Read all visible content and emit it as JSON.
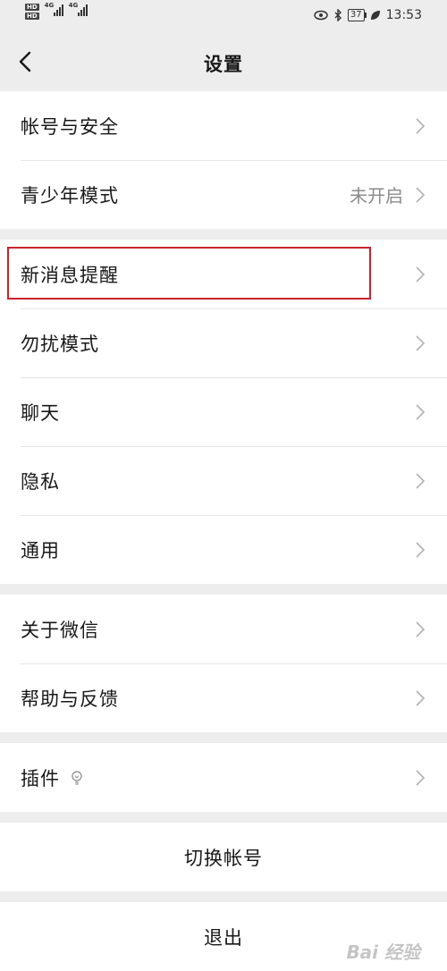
{
  "status_bar": {
    "hd1": "HD",
    "hd2": "HD",
    "net1": "4G",
    "net2": "4G",
    "battery": "37",
    "time": "13:53"
  },
  "nav": {
    "title": "设置",
    "back_icon": "chevron-left-icon"
  },
  "groups": [
    {
      "items": [
        {
          "label": "帐号与安全",
          "value": ""
        },
        {
          "label": "青少年模式",
          "value": "未开启"
        }
      ]
    },
    {
      "items": [
        {
          "label": "新消息提醒",
          "value": ""
        },
        {
          "label": "勿扰模式",
          "value": ""
        },
        {
          "label": "聊天",
          "value": ""
        },
        {
          "label": "隐私",
          "value": ""
        },
        {
          "label": "通用",
          "value": ""
        }
      ]
    },
    {
      "items": [
        {
          "label": "关于微信",
          "value": ""
        },
        {
          "label": "帮助与反馈",
          "value": ""
        }
      ]
    },
    {
      "items": [
        {
          "label": "插件",
          "value": "",
          "icon": "lightbulb-icon"
        }
      ]
    }
  ],
  "actions": {
    "switch_account": "切换帐号",
    "logout": "退出"
  },
  "highlight_color": "#c8232b",
  "watermark": "Bai 经验"
}
